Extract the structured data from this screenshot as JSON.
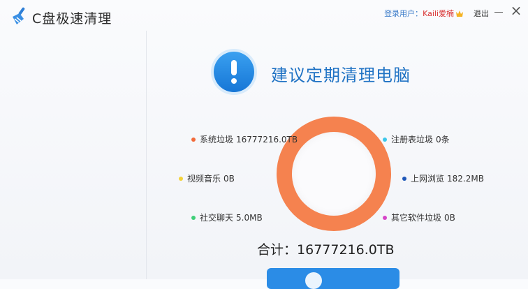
{
  "app": {
    "title": "C盘极速清理",
    "logo_icon": "broom-icon"
  },
  "header": {
    "login_label": "登录用户：",
    "username": "Kaili爱楠",
    "logout_label": "退出",
    "minimize_icon": "minimize-icon",
    "close_icon": "close-icon",
    "close_glyph": "×"
  },
  "alert": {
    "icon": "exclamation-icon",
    "headline": "建议定期清理电脑"
  },
  "categories": [
    {
      "label": "系统垃圾",
      "value": "16777216.0TB",
      "color": "#f26b3a"
    },
    {
      "label": "视频音乐",
      "value": "0B",
      "color": "#f3d23a"
    },
    {
      "label": "社交聊天",
      "value": "5.0MB",
      "color": "#3fcf78"
    },
    {
      "label": "注册表垃圾",
      "value": "0条",
      "color": "#3cc7ea"
    },
    {
      "label": "上网浏览",
      "value": "182.2MB",
      "color": "#1e57b8"
    },
    {
      "label": "其它软件垃圾",
      "value": "0B",
      "color": "#d645c8"
    }
  ],
  "donut_color": "#f5824f",
  "total": {
    "label": "合计：",
    "value": "16777216.0TB"
  },
  "clean_button": {
    "icon": "clean-icon",
    "color": "#2b8ce6"
  }
}
